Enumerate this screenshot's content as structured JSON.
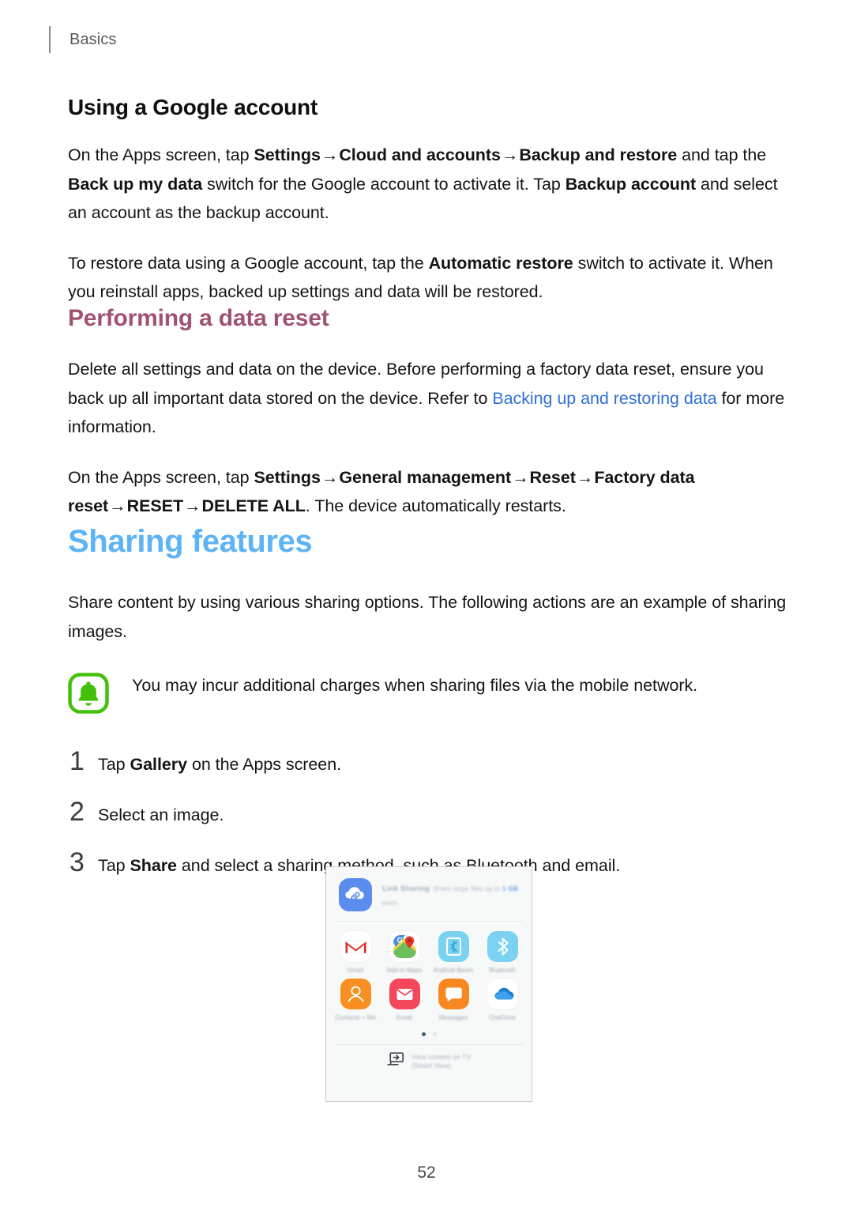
{
  "header": {
    "running_head": "Basics"
  },
  "sections": {
    "google_account": {
      "heading": "Using a Google account",
      "paragraph1": {
        "seg1": "On the Apps screen, tap ",
        "b1": "Settings",
        "arrow1": "→",
        "b2": "Cloud and accounts",
        "arrow2": "→",
        "b3": "Backup and restore",
        "seg2": " and tap the ",
        "b4": "Back up my data",
        "seg3": " switch for the Google account to activate it. Tap ",
        "b5": "Backup account",
        "seg4": " and select an account as the backup account."
      },
      "paragraph2": {
        "seg1": "To restore data using a Google account, tap the ",
        "b1": "Automatic restore",
        "seg2": " switch to activate it. When you reinstall apps, backed up settings and data will be restored."
      }
    },
    "data_reset": {
      "heading": "Performing a data reset",
      "heading_color": "#a05273",
      "paragraph1": {
        "seg1": "Delete all settings and data on the device. Before performing a factory data reset, ensure you back up all important data stored on the device. Refer to ",
        "link": "Backing up and restoring data",
        "link_color": "#2f6fd8",
        "seg2": " for more information."
      },
      "paragraph2": {
        "seg1": "On the Apps screen, tap ",
        "b1": "Settings",
        "arrow1": "→",
        "b2": "General management",
        "arrow2": "→",
        "b3": "Reset",
        "arrow3": "→",
        "b4": "Factory data reset",
        "arrow4": "→",
        "b5": "RESET",
        "arrow5": "→",
        "b6": "DELETE ALL",
        "seg2": ". The device automatically restarts."
      }
    },
    "sharing_features": {
      "heading": "Sharing features",
      "heading_color": "#5cb3f5",
      "intro": "Share content by using various sharing options. The following actions are an example of sharing images.",
      "note": {
        "icon": "bell-icon",
        "icon_color": "#43c10a",
        "text": "You may incur additional charges when sharing files via the mobile network."
      },
      "steps": [
        {
          "number": "1",
          "seg1": "Tap ",
          "bold": "Gallery",
          "seg2": " on the Apps screen."
        },
        {
          "number": "2",
          "seg1": "Select an image.",
          "bold": "",
          "seg2": ""
        },
        {
          "number": "3",
          "seg1": "Tap ",
          "bold": "Share",
          "seg2": " and select a sharing method, such as Bluetooth and email."
        }
      ]
    }
  },
  "figure": {
    "link_sharing": {
      "icon": "link-cloud-icon",
      "title": "Link Sharing",
      "subtitle_prefix": "Share large files up to ",
      "subtitle_highlight": "1 GB",
      "subtitle_suffix": " each."
    },
    "apps": [
      {
        "label": "Gmail",
        "icon": "gmail-icon",
        "color": "#ffffff"
      },
      {
        "label": "Add to Maps",
        "icon": "google-maps-icon",
        "color": "#ffffff"
      },
      {
        "label": "Android Beam",
        "icon": "android-beam-icon",
        "color": "#7ad2f0"
      },
      {
        "label": "Bluetooth",
        "icon": "bluetooth-icon",
        "color": "#7ad2f0"
      },
      {
        "label": "Contacts + Me",
        "icon": "contacts-icon",
        "color": "#f79020"
      },
      {
        "label": "Email",
        "icon": "email-icon",
        "color": "#f4475b"
      },
      {
        "label": "Messages",
        "icon": "messages-icon",
        "color": "#f7871f"
      },
      {
        "label": "OneDrive",
        "icon": "onedrive-icon",
        "color": "#ffffff"
      }
    ],
    "pager": {
      "active_index": 0,
      "count": 2
    },
    "smart_view": {
      "icon": "smart-view-icon",
      "line1": "View content on TV",
      "line2": "(Smart View)"
    }
  },
  "footer": {
    "page_number": "52"
  }
}
